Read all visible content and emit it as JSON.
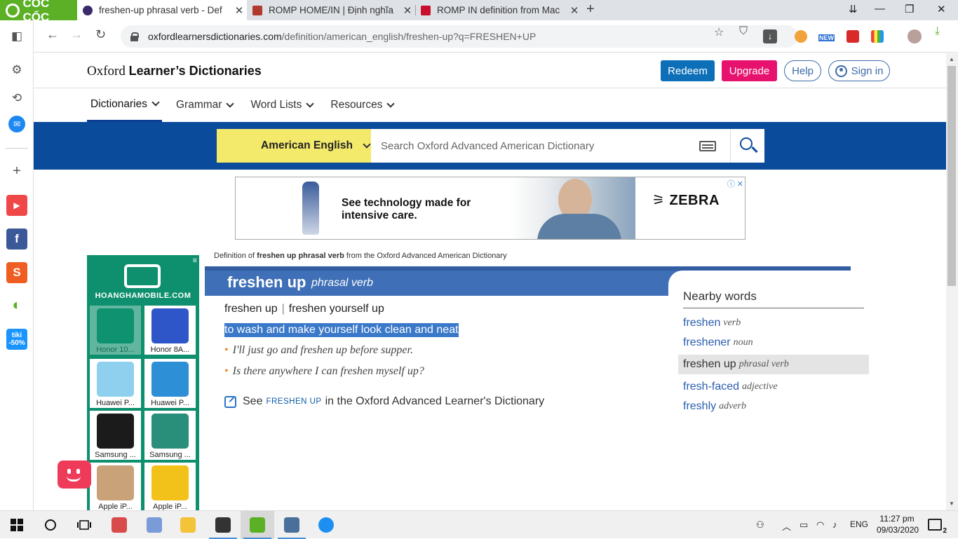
{
  "browser": {
    "brand": "CỐC CỐC",
    "tabs": [
      {
        "title": "freshen-up phrasal verb - Def",
        "active": true
      },
      {
        "title": "ROMP HOME/IN | Định nghĩa",
        "active": false
      },
      {
        "title": "ROMP IN definition from Mac",
        "active": false
      }
    ],
    "new_tab": "+",
    "url_host": "oxfordlearnersdictionaries.com",
    "url_path": "/definition/american_english/freshen-up?q=FRESHEN+UP",
    "ext_badge": "NEW",
    "window_controls": {
      "minimize": "—",
      "maximize": "❐",
      "close": "✕",
      "restore": "⇊"
    }
  },
  "sidebar": {
    "items": [
      {
        "name": "panel-toggle-icon",
        "glyph": "◧"
      },
      {
        "name": "settings-icon",
        "glyph": "⚙"
      },
      {
        "name": "history-icon",
        "glyph": "⟲"
      },
      {
        "name": "messenger-icon",
        "glyph": "✉"
      },
      {
        "name": "add-icon",
        "glyph": "+"
      },
      {
        "name": "youtube-icon",
        "glyph": "▶"
      },
      {
        "name": "facebook-icon",
        "glyph": "f"
      },
      {
        "name": "shopee-icon",
        "glyph": "S"
      },
      {
        "name": "coccoc-app-icon",
        "glyph": "◐"
      },
      {
        "name": "tiki-icon",
        "glyph": "tiki -50%"
      }
    ]
  },
  "site": {
    "logo_plain": "Oxford",
    "logo_bold": "Learner’s Dictionaries",
    "buttons": {
      "redeem": "Redeem",
      "upgrade": "Upgrade",
      "help": "Help",
      "signin": "Sign in"
    },
    "nav": [
      {
        "label": "Dictionaries",
        "active": true
      },
      {
        "label": "Grammar",
        "active": false
      },
      {
        "label": "Word Lists",
        "active": false
      },
      {
        "label": "Resources",
        "active": false
      }
    ],
    "dictionary_select": "American English",
    "search_placeholder": "Search Oxford Advanced American Dictionary"
  },
  "ad": {
    "headline": "See technology made for intensive care.",
    "brand": "ZEBRA",
    "choices": "ⓘ ✕"
  },
  "side_ad": {
    "menu": "≡",
    "brand": "HOANGHAMOBILE.COM",
    "phones": [
      {
        "label": "Honor 10...",
        "faded": true,
        "color": "#0f9a76"
      },
      {
        "label": "Honor 8A...",
        "faded": false,
        "color": "#2f56c8"
      },
      {
        "label": "Huawei P...",
        "faded": false,
        "color": "#8fd0ee"
      },
      {
        "label": "Huawei P...",
        "faded": false,
        "color": "#2d8fd6"
      },
      {
        "label": "Samsung ...",
        "faded": false,
        "color": "#1b1b1b"
      },
      {
        "label": "Samsung ...",
        "faded": false,
        "color": "#2a8f7a"
      },
      {
        "label": "Apple iP...",
        "faded": false,
        "color": "#c9a27a"
      },
      {
        "label": "Apple iP...",
        "faded": false,
        "color": "#f2c21a"
      }
    ]
  },
  "entry": {
    "note_prefix": "Definition of ",
    "note_term": "freshen up phrasal verb",
    "note_suffix": " from the Oxford Advanced American Dictionary",
    "headword": "freshen up",
    "pos": "phrasal verb",
    "form1": "freshen up",
    "form_sep": "|",
    "form2": "freshen yourself up",
    "definition": "to wash and make yourself look clean and neat",
    "examples": [
      "I'll just go and freshen up before supper.",
      "Is there anywhere I can freshen myself up?"
    ],
    "see_prefix": "See",
    "see_term": "freshen up",
    "see_suffix": "in the Oxford Advanced Learner's Dictionary"
  },
  "nearby": {
    "title": "Nearby words",
    "items": [
      {
        "word": "freshen",
        "pos": "verb",
        "selected": false
      },
      {
        "word": "freshener",
        "pos": "noun",
        "selected": false
      },
      {
        "word": "freshen up",
        "pos": "phrasal verb",
        "selected": true
      },
      {
        "word": "fresh-faced",
        "pos": "adjective",
        "selected": false
      },
      {
        "word": "freshly",
        "pos": "adverb",
        "selected": false
      }
    ]
  },
  "taskbar": {
    "lang": "ENG",
    "time": "11:27 pm",
    "date": "09/03/2020",
    "notifications": "2",
    "apps": [
      {
        "name": "taskbar-app-paint",
        "color": "#d94a4a",
        "open": false
      },
      {
        "name": "taskbar-app-snipping",
        "color": "#7a9ad8",
        "open": false
      },
      {
        "name": "taskbar-app-explorer",
        "color": "#f3c33a",
        "open": false
      },
      {
        "name": "taskbar-app-terminal",
        "color": "#333333",
        "open": true
      },
      {
        "name": "taskbar-app-coccoc",
        "color": "#5bb025",
        "open": true
      },
      {
        "name": "taskbar-app-tool",
        "color": "#4a6f9a",
        "open": true
      },
      {
        "name": "taskbar-app-zalo",
        "color": "#1d8ff2",
        "open": false
      }
    ]
  },
  "colors": {
    "brand_blue": "#0b4b9c",
    "header_blue": "#3f6fb6",
    "yellow": "#f3e96b",
    "magenta": "#e6126e",
    "coccoc_green": "#5bb025"
  }
}
